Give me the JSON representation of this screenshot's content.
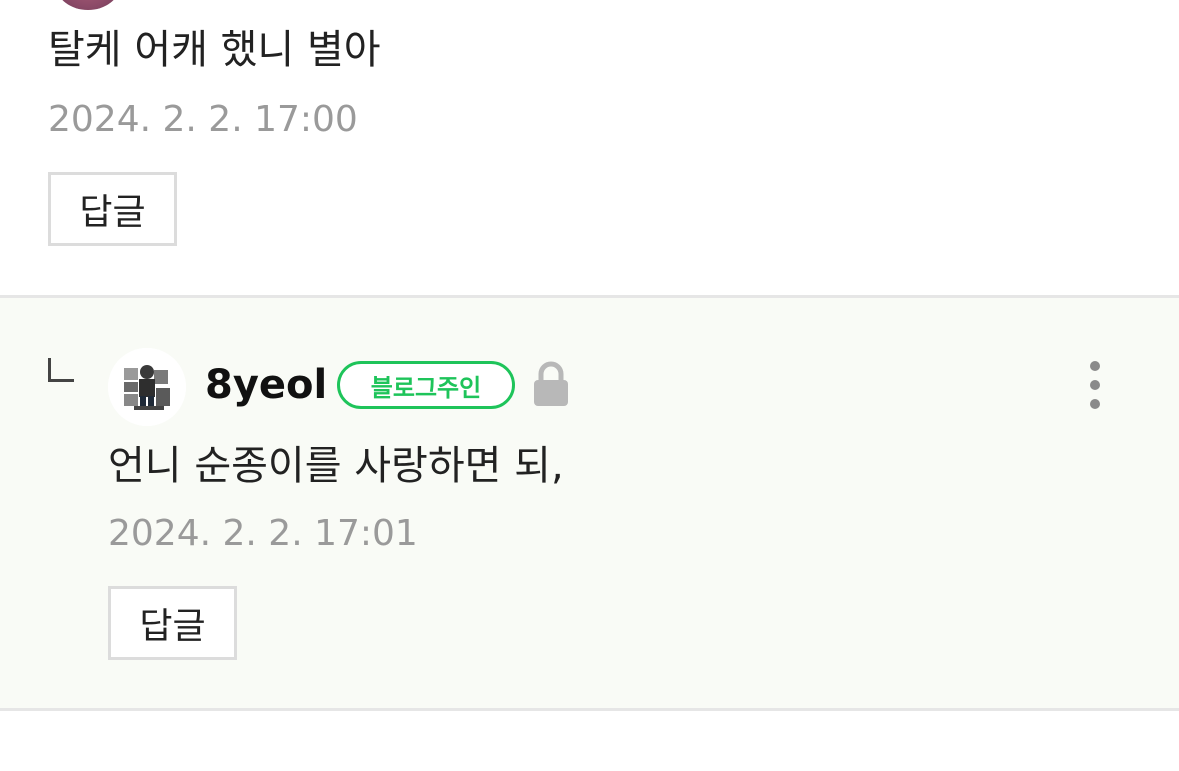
{
  "parent_comment": {
    "text": "탈케 어캐 했니 별아",
    "date": "2024. 2. 2. 17:00",
    "reply_label": "답글"
  },
  "reply_comment": {
    "nickname": "8yeol",
    "badge": "블로그주인",
    "text": "언니 순종이를 사랑하면 되,",
    "date": "2024. 2. 2. 17:01",
    "reply_label": "답글"
  },
  "icons": {
    "reply_indicator": "reply-arrow-icon",
    "lock": "lock-icon",
    "more": "more-vertical-icon"
  },
  "colors": {
    "badge_green": "#1ec45a",
    "reply_background": "#f9fbf6",
    "date_gray": "#9a9a9a"
  }
}
